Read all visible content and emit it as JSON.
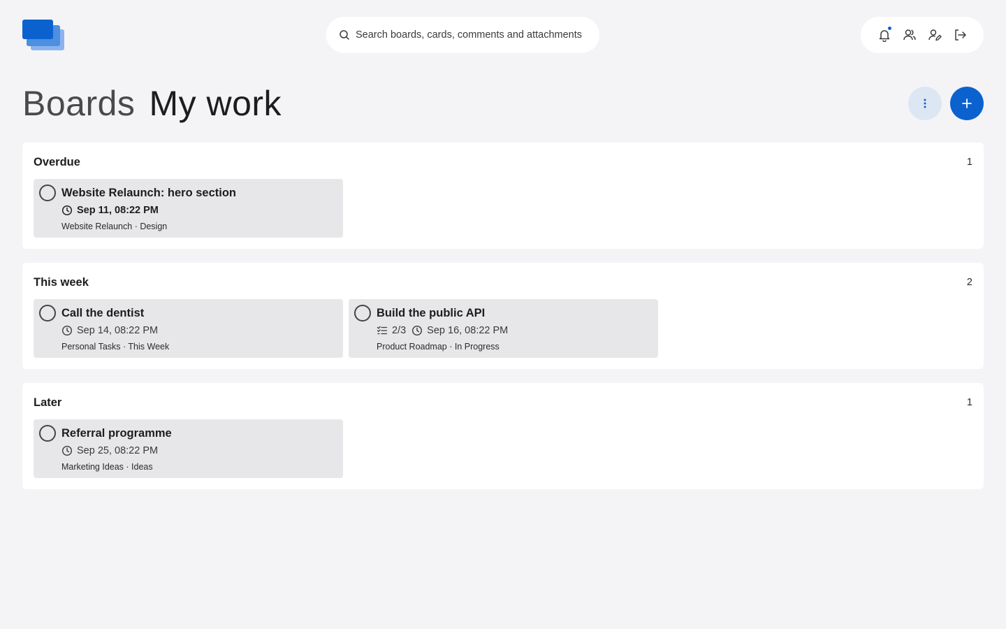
{
  "header": {
    "search_placeholder": "Search boards, cards, comments and attachments"
  },
  "title": {
    "boards": "Boards",
    "my_work": "My work"
  },
  "colors": {
    "accent": "#0b62cf",
    "background": "#f4f4f6",
    "card": "#e7e7e9"
  },
  "sections": [
    {
      "title": "Overdue",
      "count": "1",
      "cards": [
        {
          "title": "Website Relaunch: hero section",
          "due": "Sep 11, 08:22 PM",
          "path": "Website Relaunch · Design",
          "overdue": true
        }
      ]
    },
    {
      "title": "This week",
      "count": "2",
      "cards": [
        {
          "title": "Call the dentist",
          "due": "Sep 14, 08:22 PM",
          "path": "Personal Tasks · This Week"
        },
        {
          "title": "Build the public API",
          "subtasks": "2/3",
          "due": "Sep 16, 08:22 PM",
          "path": "Product Roadmap · In Progress"
        }
      ]
    },
    {
      "title": "Later",
      "count": "1",
      "cards": [
        {
          "title": "Referral programme",
          "due": "Sep 25, 08:22 PM",
          "path": "Marketing Ideas · Ideas"
        }
      ]
    }
  ]
}
